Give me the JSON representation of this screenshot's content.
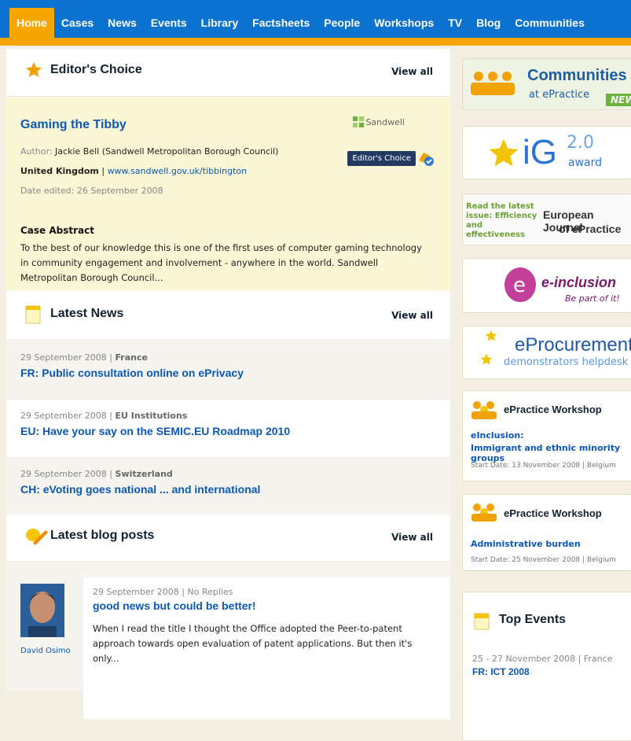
{
  "nav": [
    "Home",
    "Cases",
    "News",
    "Events",
    "Library",
    "Factsheets",
    "People",
    "Workshops",
    "TV",
    "Blog",
    "Communities"
  ],
  "editors_choice": {
    "title": "Editor's Choice",
    "view_all": "View all",
    "case_title": "Gaming the Tibby",
    "author_label": "Author:",
    "author": "Jackie Bell (Sandwell Metropolitan Borough Council)",
    "country": "United Kingdom",
    "url": "www.sandwell.gov.uk/tibbington",
    "date_edited": "Date edited: 26 September 2008",
    "abstract_heading": "Case Abstract",
    "abstract": "To the best of our knowledge this is one of the first uses of computer gaming technology in community engagement and involvement - anywhere in the world. Sandwell Metropolitan Borough Council...",
    "logo_text": "Sandwell",
    "badge": "Editor's Choice"
  },
  "latest_news": {
    "title": "Latest News",
    "view_all": "View all",
    "items": [
      {
        "date": "29 September 2008",
        "region": "France",
        "headline": "FR: Public consultation online on ePrivacy"
      },
      {
        "date": "29 September 2008",
        "region": "EU Institutions",
        "headline": "EU: Have your say on the SEMIC.EU Roadmap 2010"
      },
      {
        "date": "29 September 2008",
        "region": "Switzerland",
        "headline": "CH: eVoting goes national ... and international"
      }
    ]
  },
  "latest_blog": {
    "title": "Latest blog posts",
    "view_all": "View all",
    "post": {
      "meta": "29 September 2008 | No Replies",
      "title": "good news but could be better!",
      "excerpt": "When I read the title I thought the Office adopted the Peer-to-patent approach towards open evaluation of patent applications. But then it's only...",
      "author": "David Osimo"
    }
  },
  "sidebar": {
    "communities": {
      "title": "Communities",
      "sub": "at ePractice",
      "flag": "NEW"
    },
    "ig": {
      "text": "iG",
      "version": "2.0",
      "award": "award"
    },
    "journal": {
      "left": "Read the latest issue: Efficiency and effectiveness",
      "right1": "European Journal",
      "right2": "of ePractice"
    },
    "einclusion": {
      "title": "e-inclusion",
      "sub": "Be part of it!"
    },
    "eprocurement": {
      "title": "eProcurement",
      "sub": "demonstrators helpdesk"
    },
    "workshops": [
      {
        "title": "ePractice Workshop",
        "sub1": "eInclusion:",
        "sub2": "Immigrant and ethnic minority groups",
        "start": "Start Date:    13 November 2008 | Belgium"
      },
      {
        "title": "ePractice Workshop",
        "sub1": "Administrative burden",
        "start": "Start Date:    25 November 2008 | Belgium"
      }
    ],
    "top_events": {
      "title": "Top Events",
      "meta": "25 - 27 November 2008 | France",
      "headline": "FR: ICT 2008"
    }
  }
}
